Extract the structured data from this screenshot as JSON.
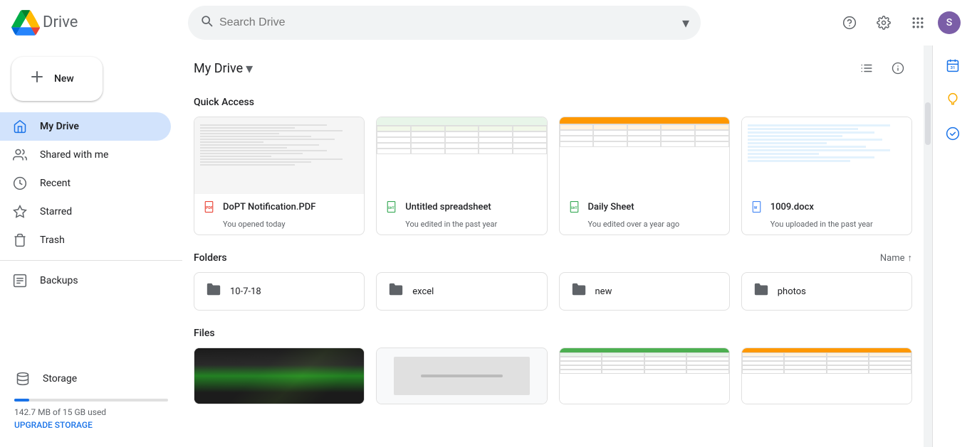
{
  "app": {
    "name": "Drive",
    "logo_text": "Drive",
    "avatar_letter": "S",
    "avatar_bg": "#7B5EA7"
  },
  "topbar": {
    "search_placeholder": "Search Drive",
    "help_icon": "?",
    "settings_icon": "⚙",
    "apps_icon": "⠿"
  },
  "sidebar": {
    "new_label": "New",
    "items": [
      {
        "id": "my-drive",
        "label": "My Drive",
        "icon": "folder",
        "active": true
      },
      {
        "id": "shared-with-me",
        "label": "Shared with me",
        "icon": "people",
        "active": false
      },
      {
        "id": "recent",
        "label": "Recent",
        "icon": "clock",
        "active": false
      },
      {
        "id": "starred",
        "label": "Starred",
        "icon": "star",
        "active": false
      },
      {
        "id": "trash",
        "label": "Trash",
        "icon": "trash",
        "active": false
      }
    ],
    "backups_label": "Backups",
    "storage_label": "Storage",
    "storage_used": "142.7 MB of 15 GB used",
    "upgrade_label": "UPGRADE STORAGE"
  },
  "main": {
    "drive_title": "My Drive",
    "quick_access_title": "Quick Access",
    "folders_title": "Folders",
    "files_title": "Files",
    "sort_label": "Name",
    "quick_access_items": [
      {
        "id": "qa1",
        "filename": "DoPT Notification.PDF",
        "subtext": "You opened today",
        "icon_type": "pdf",
        "preview_type": "pdf"
      },
      {
        "id": "qa2",
        "filename": "Untitled spreadsheet",
        "subtext": "You edited in the past year",
        "icon_type": "sheets",
        "preview_type": "sheets"
      },
      {
        "id": "qa3",
        "filename": "Daily Sheet",
        "subtext": "You edited over a year ago",
        "icon_type": "sheets",
        "preview_type": "sheets_orange"
      },
      {
        "id": "qa4",
        "filename": "1009.docx",
        "subtext": "You uploaded in the past year",
        "icon_type": "word",
        "preview_type": "doc"
      }
    ],
    "folders": [
      {
        "id": "f1",
        "name": "10-7-18"
      },
      {
        "id": "f2",
        "name": "excel"
      },
      {
        "id": "f3",
        "name": "new"
      },
      {
        "id": "f4",
        "name": "photos"
      }
    ],
    "files": [
      {
        "id": "file1",
        "preview_type": "photo"
      },
      {
        "id": "file2",
        "preview_type": "blank"
      },
      {
        "id": "file3",
        "preview_type": "sheets_green"
      },
      {
        "id": "file4",
        "preview_type": "sheets_orange2"
      }
    ]
  },
  "right_sidebar": {
    "calendar_icon": "📅",
    "keep_icon": "💡",
    "tasks_icon": "✓"
  }
}
